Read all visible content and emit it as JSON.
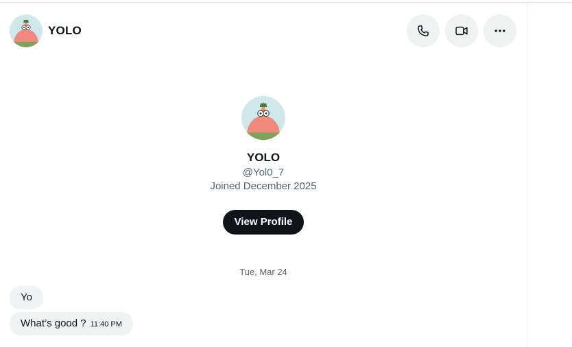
{
  "header": {
    "name": "YOLO",
    "avatar_icon": "patrick-avatar-icon",
    "actions": [
      {
        "name": "call",
        "icon": "phone-icon"
      },
      {
        "name": "video",
        "icon": "video-camera-icon"
      },
      {
        "name": "more",
        "icon": "more-horizontal-icon"
      }
    ]
  },
  "profile": {
    "name": "YOLO",
    "handle": "@Yol0_7",
    "joined": "Joined December 2025",
    "view_profile_label": "View Profile"
  },
  "conversation": {
    "date_label": "Tue, Mar 24",
    "messages": [
      {
        "text": "Yo",
        "time": ""
      },
      {
        "text": "What’s good ?",
        "time": "11:40 PM"
      }
    ]
  },
  "colors": {
    "primary_text": "#0f1419",
    "secondary_text": "#536471",
    "bubble_bg": "#eff3f4",
    "button_dark": "#0f1419"
  }
}
